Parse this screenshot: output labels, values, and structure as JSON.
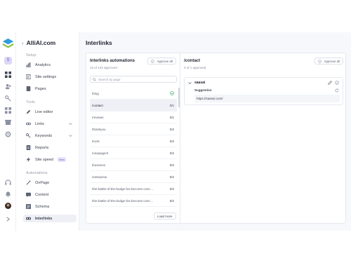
{
  "app": {
    "brand": "AlliAI.com",
    "avatar_initial": "S"
  },
  "sidebar": {
    "sections": [
      {
        "label": "Setup"
      },
      {
        "label": "Tools"
      },
      {
        "label": "Automations"
      }
    ],
    "items": [
      {
        "label": "Analytics",
        "icon": "bar-chart-icon"
      },
      {
        "label": "Site settings",
        "icon": "sliders-icon"
      },
      {
        "label": "Pages",
        "icon": "pages-icon"
      },
      {
        "label": "Live editor",
        "icon": "editor-icon"
      },
      {
        "label": "Links",
        "icon": "link-icon"
      },
      {
        "label": "Keywords",
        "icon": "key-icon"
      },
      {
        "label": "Reports",
        "icon": "report-icon"
      },
      {
        "label": "Site speed",
        "icon": "bolt-icon",
        "badge": "New"
      },
      {
        "label": "OnPage",
        "icon": "wand-icon"
      },
      {
        "label": "Content",
        "icon": "content-icon"
      },
      {
        "label": "Schema",
        "icon": "schema-icon"
      },
      {
        "label": "Interlinks",
        "icon": "link-icon",
        "active": true
      }
    ]
  },
  "main": {
    "title": "Interlinks"
  },
  "left_panel": {
    "title": "Interlinks automations",
    "subtitle": "13 of 134 approved",
    "approve_all": "Approve all",
    "search_placeholder": "Search by page",
    "rows": [
      {
        "path": "/blog",
        "count": "",
        "approved": true
      },
      {
        "path": "/contact",
        "count": "0/1",
        "selected": true
      },
      {
        "path": "/reviews",
        "count": "0/1"
      },
      {
        "path": "/thankyou",
        "count": "0/2"
      },
      {
        "path": "/tools",
        "count": "0/2"
      },
      {
        "path": "/newpage/3",
        "count": "0/2"
      },
      {
        "path": "/business",
        "count": "0/2"
      },
      {
        "path": "/enterprise",
        "count": "0/2"
      },
      {
        "path": "/the-battle-of-the-budge-fos-become-cost-...",
        "count": "0/2"
      },
      {
        "path": "/the-battle-of-the-budge-fos-become-cost-...",
        "count": "0/2"
      }
    ],
    "load_more": "Load more"
  },
  "right_panel": {
    "title": "/contact",
    "subtitle": "0 of 1 approved",
    "approve_all": "Approve all",
    "keyword": "saasai",
    "suggestion_label": "Suggestion",
    "suggestion_url": "https://saasai.com/"
  },
  "colors": {
    "accent": "#6a5bd1",
    "success": "#3aa86b",
    "logo_blue": "#2f9be0",
    "logo_green": "#8bc34a"
  }
}
